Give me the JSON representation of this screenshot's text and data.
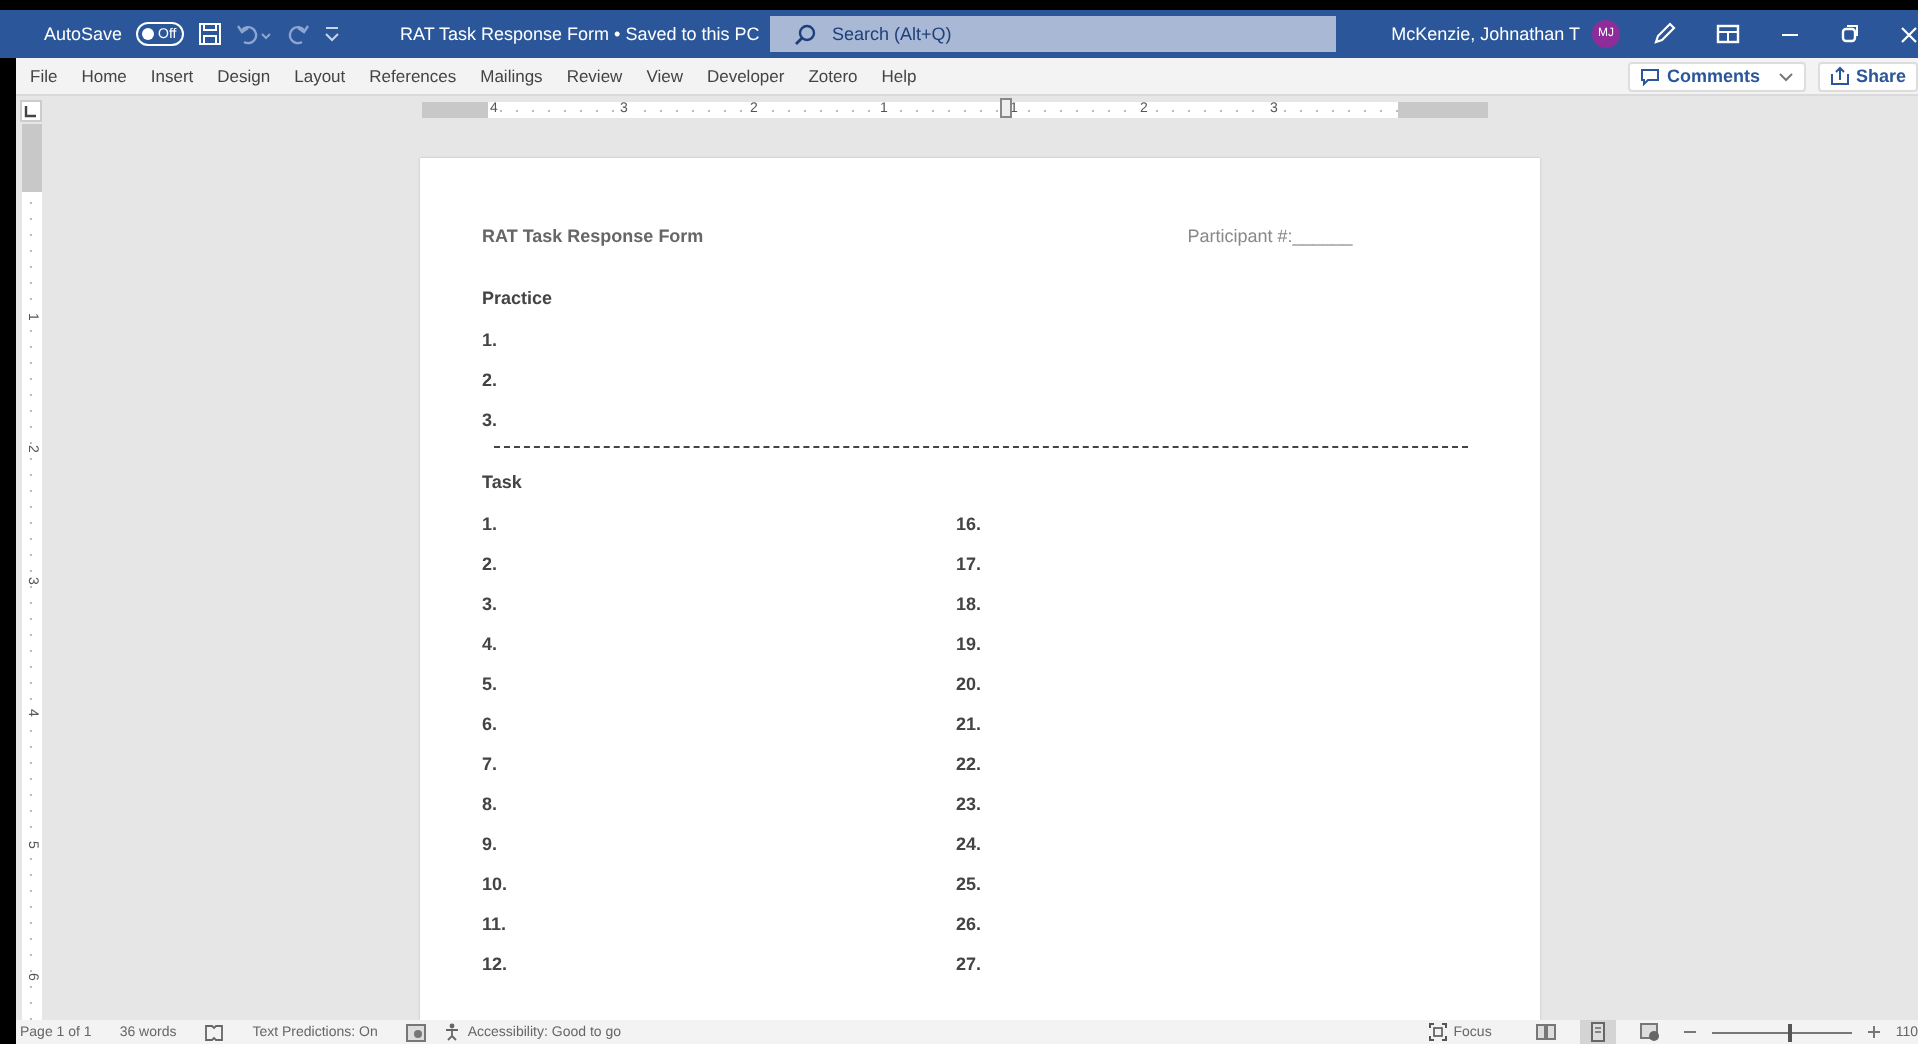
{
  "title_bar": {
    "autosave_label": "AutoSave",
    "autosave_toggle": {
      "label": "Off",
      "on": false
    },
    "document_title": "RAT Task Response Form • Saved to this PC",
    "search": {
      "placeholder": "Search (Alt+Q)"
    },
    "user_name": "McKenzie, Johnathan T",
    "avatar_initials": "MJ"
  },
  "ribbon_tabs": [
    "File",
    "Home",
    "Insert",
    "Design",
    "Layout",
    "References",
    "Mailings",
    "Review",
    "View",
    "Developer",
    "Zotero",
    "Help"
  ],
  "ribbon_buttons": {
    "comments": "Comments",
    "share": "Share"
  },
  "ruler": {
    "horizontal_labels": [
      "4",
      "3",
      "2",
      "1",
      "1",
      "2",
      "3"
    ],
    "vertical_labels": [
      "1",
      "2",
      "3",
      "4",
      "5",
      "6"
    ]
  },
  "document": {
    "title": "RAT Task Response Form",
    "participant": "Participant #:______",
    "practice": {
      "heading": "Practice",
      "items": [
        "1.",
        "2.",
        "3."
      ]
    },
    "task": {
      "heading": "Task",
      "left_items": [
        "1.",
        "2.",
        "3.",
        "4.",
        "5.",
        "6.",
        "7.",
        "8.",
        "9.",
        "10.",
        "11.",
        "12."
      ],
      "right_items": [
        "16.",
        "17.",
        "18.",
        "19.",
        "20.",
        "21.",
        "22.",
        "23.",
        "24.",
        "25.",
        "26.",
        "27."
      ]
    }
  },
  "status_bar": {
    "page": "Page 1 of 1",
    "words": "36 words",
    "text_predictions": "Text Predictions: On",
    "accessibility": "Accessibility: Good to go",
    "focus": "Focus",
    "views": [
      {
        "kind": "read",
        "selected": false
      },
      {
        "kind": "print",
        "selected": true
      },
      {
        "kind": "web",
        "selected": false
      }
    ],
    "zoom": {
      "level": 0.55,
      "reading": "110"
    }
  }
}
